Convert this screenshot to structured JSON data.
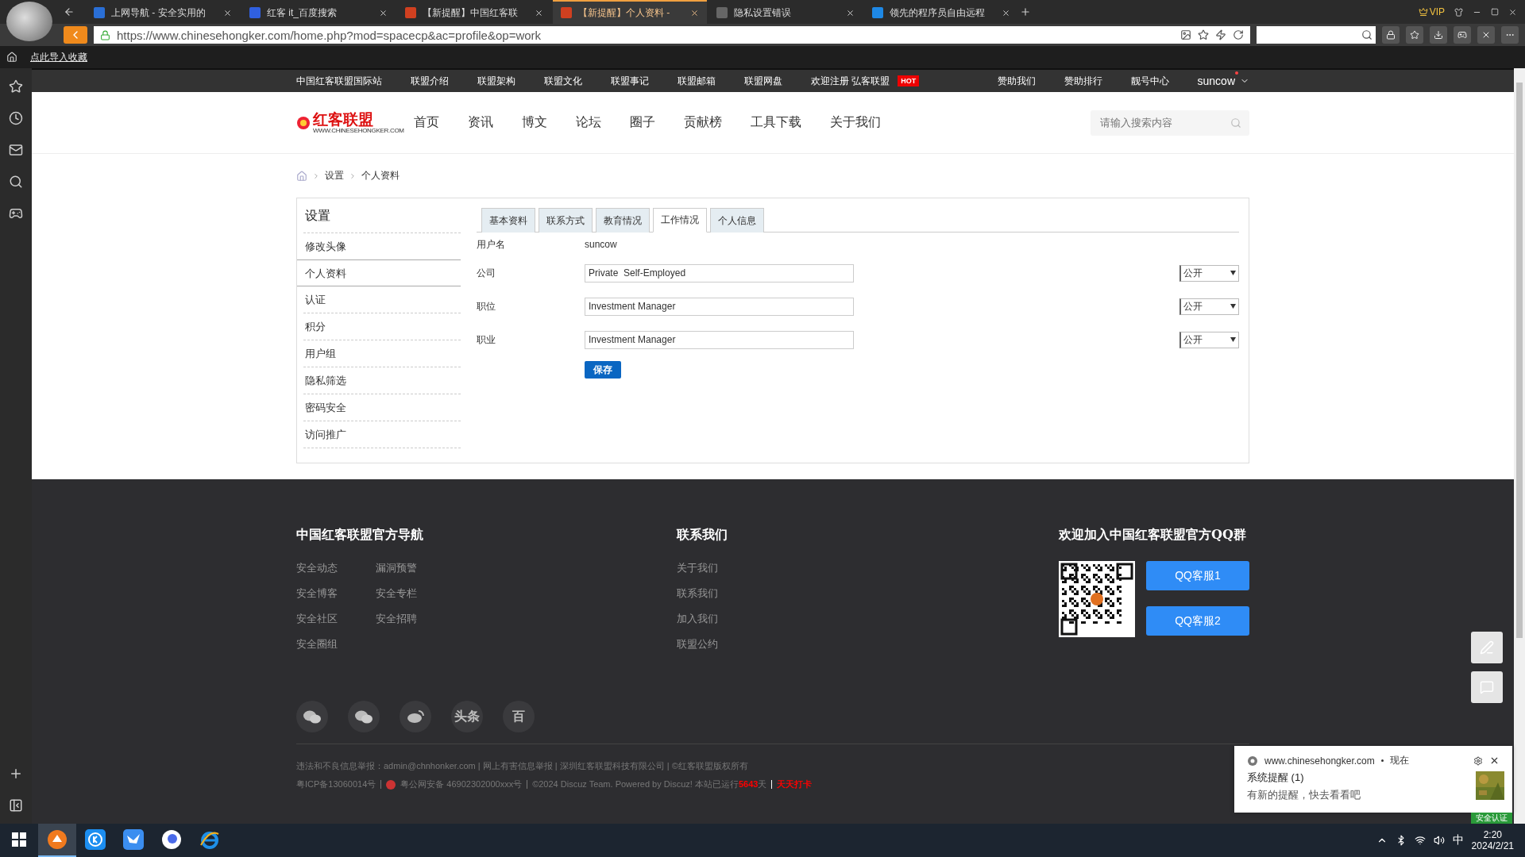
{
  "browser": {
    "tabs": [
      {
        "title": "上网导航 - 安全实用的",
        "selected": false,
        "color": "#2a6fd6"
      },
      {
        "title": "红客 it_百度搜索",
        "selected": false,
        "color": "#3060e0"
      },
      {
        "title": "【新提醒】中国红客联",
        "selected": false,
        "color": "#d04020"
      },
      {
        "title": "【新提醒】个人资料 -",
        "selected": true,
        "color": "#d04020"
      },
      {
        "title": "隐私设置错误",
        "selected": false,
        "color": "#666666"
      },
      {
        "title": "领先的程序员自由远程",
        "selected": false,
        "color": "#1e88e5"
      }
    ],
    "vip": "VIP",
    "url": "https://www.chinesehongker.com/home.php?mod=spacecp&ac=profile&op=work",
    "bookmark": "点此导入收藏"
  },
  "site": {
    "top_nav": {
      "left": [
        "中国红客联盟国际站",
        "联盟介绍",
        "联盟架构",
        "联盟文化",
        "联盟事记",
        "联盟邮箱",
        "联盟网盘",
        "欢迎注册 弘客联盟"
      ],
      "hot": "HOT",
      "right": [
        "赞助我们",
        "赞助排行",
        "靓号中心"
      ],
      "user": "suncow"
    },
    "header": {
      "logo": "红客联盟",
      "logo_subtitle": "WWW.CHINESEHONGKER.COM",
      "nav": [
        "首页",
        "资讯",
        "博文",
        "论坛",
        "圈子",
        "贡献榜",
        "工具下载",
        "关于我们"
      ],
      "search": {
        "placeholder": "请输入搜索内容"
      }
    },
    "breadcrumb": [
      "设置",
      "个人资料"
    ],
    "settings": {
      "title": "设置",
      "menu": [
        {
          "label": "修改头像",
          "selected": false
        },
        {
          "label": "个人资料",
          "selected": true
        },
        {
          "label": "认证",
          "selected": false
        },
        {
          "label": "积分",
          "selected": false
        },
        {
          "label": "用户组",
          "selected": false
        },
        {
          "label": "隐私筛选",
          "selected": false
        },
        {
          "label": "密码安全",
          "selected": false
        },
        {
          "label": "访问推广",
          "selected": false
        }
      ],
      "tabs": [
        {
          "label": "基本资料",
          "selected": false
        },
        {
          "label": "联系方式",
          "selected": false
        },
        {
          "label": "教育情况",
          "selected": false
        },
        {
          "label": "工作情况",
          "selected": true
        },
        {
          "label": "个人信息",
          "selected": false
        }
      ],
      "username": {
        "label": "用户名",
        "value": "suncow"
      },
      "fields": [
        {
          "label": "公司",
          "value": "Private  Self-Employed",
          "privacy": "公开"
        },
        {
          "label": "职位",
          "value": "Investment Manager",
          "privacy": "公开"
        },
        {
          "label": "职业",
          "value": "Investment Manager",
          "privacy": "公开"
        }
      ],
      "save": "保存"
    },
    "footer": {
      "nav": {
        "heading": "中国红客联盟官方导航",
        "links": [
          "安全动态",
          "漏洞预警",
          "安全博客",
          "安全专栏",
          "安全社区",
          "安全招聘",
          "安全圈组"
        ]
      },
      "contact": {
        "heading": "联系我们",
        "links": [
          "关于我们",
          "联系我们",
          "加入我们",
          "联盟公约"
        ]
      },
      "qq": {
        "heading": "欢迎加入中国红客联盟官方QQ群",
        "buttons": [
          "QQ客服1",
          "QQ客服2"
        ]
      },
      "social": [
        {
          "kind": "wechat"
        },
        {
          "kind": "wechat"
        },
        {
          "kind": "weibo"
        },
        {
          "kind": "text",
          "label": "头条"
        },
        {
          "kind": "text",
          "label": "百"
        }
      ],
      "legal": [
        "违法和不良信息举报：admin@chnhonker.com | 网上有害信息举报 | 深圳红客联盟科技有限公司 | ©红客联盟版权所有"
      ],
      "icp": "粤ICP备13060014号",
      "police": "粤公网安备 46902302000xxx号",
      "powered": "©2024 Discuz Team. Powered by Discuz! 本站已运行**5643**天",
      "checkin": "天天打卡"
    }
  },
  "notification": {
    "site": "www.chinesehongker.com",
    "time": "现在",
    "title": "系统提醒 (1)",
    "body": "有新的提醒，快去看看吧",
    "badge": "安全认证"
  },
  "taskbar": {
    "apps": [
      {
        "kind": "browser",
        "active": true
      },
      {
        "kind": "k",
        "active": false
      },
      {
        "kind": "bird",
        "active": false
      },
      {
        "kind": "circle",
        "active": false
      },
      {
        "kind": "ie",
        "active": false
      }
    ],
    "ime": "中",
    "time": "2:20",
    "date": "2024/2/21"
  }
}
